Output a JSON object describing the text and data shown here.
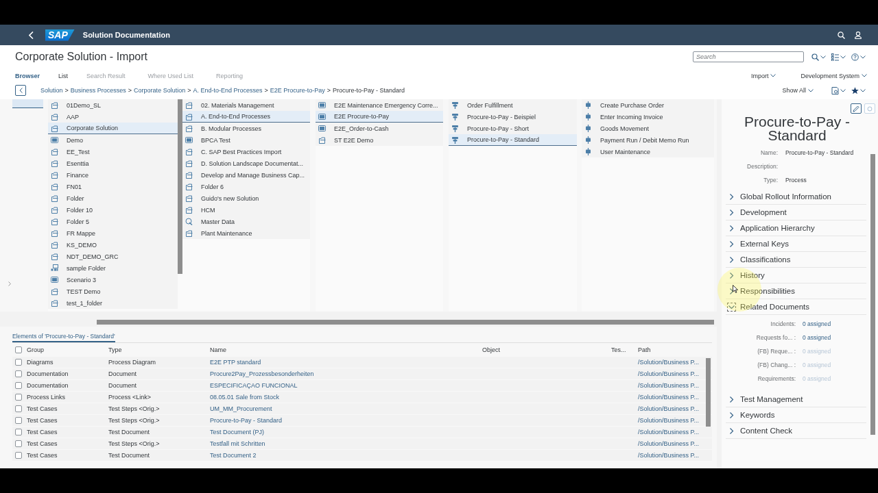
{
  "shell": {
    "title": "Solution Documentation",
    "logo": "SAP"
  },
  "header": {
    "title": "Corporate Solution - Import",
    "search": {
      "placeholder": "Search"
    },
    "tabs": [
      {
        "label": "Browser",
        "selected": true,
        "disabled": false
      },
      {
        "label": "List",
        "selected": false,
        "disabled": false
      },
      {
        "label": "Search Result",
        "selected": false,
        "disabled": true
      },
      {
        "label": "Where Used List",
        "selected": false,
        "disabled": true
      },
      {
        "label": "Reporting",
        "selected": false,
        "disabled": true
      }
    ],
    "menus": [
      "Import",
      "Development System"
    ],
    "breadcrumb": {
      "separator": ">",
      "items": [
        {
          "label": "Solution",
          "current": false
        },
        {
          "label": "Business Processes",
          "current": false
        },
        {
          "label": "Corporate Solution",
          "current": false
        },
        {
          "label": "A. End-to-End Processes",
          "current": false
        },
        {
          "label": "E2E Procure-to-Pay",
          "current": false
        },
        {
          "label": "Procure-to-Pay - Standard",
          "current": true
        }
      ]
    },
    "show_all": "Show All"
  },
  "columns": [
    {
      "items": [
        {
          "label": "01Demo_SL",
          "kind": "folder",
          "selected": false
        },
        {
          "label": "AAP",
          "kind": "folder",
          "selected": false
        },
        {
          "label": "Corporate Solution",
          "kind": "folder",
          "selected": true
        },
        {
          "label": "Demo",
          "kind": "scenario",
          "selected": false
        },
        {
          "label": "EE_Test",
          "kind": "folder",
          "selected": false
        },
        {
          "label": "Esenttia",
          "kind": "folder",
          "selected": false
        },
        {
          "label": "Finance",
          "kind": "folder",
          "selected": false
        },
        {
          "label": "FN01",
          "kind": "folder",
          "selected": false
        },
        {
          "label": "Folder",
          "kind": "folder",
          "selected": false
        },
        {
          "label": "Folder 10",
          "kind": "folder",
          "selected": false
        },
        {
          "label": "Folder 5",
          "kind": "folder",
          "selected": false
        },
        {
          "label": "FR Mappe",
          "kind": "folder",
          "selected": false
        },
        {
          "label": "KS_DEMO",
          "kind": "folder",
          "selected": false
        },
        {
          "label": "NDT_DEMO_GRC",
          "kind": "folder",
          "selected": false
        },
        {
          "label": "sample Folder",
          "kind": "structure",
          "selected": false
        },
        {
          "label": "Scenario 3",
          "kind": "scenario",
          "selected": false
        },
        {
          "label": "TEST Demo",
          "kind": "folder",
          "selected": false
        },
        {
          "label": "test_1_folder",
          "kind": "folder",
          "selected": false
        }
      ]
    },
    {
      "items": [
        {
          "label": "02. Materials Management",
          "kind": "folder",
          "selected": false
        },
        {
          "label": "A. End-to-End Processes",
          "kind": "folder",
          "selected": true
        },
        {
          "label": "B. Modular Processes",
          "kind": "folder",
          "selected": false
        },
        {
          "label": "BPCA Test",
          "kind": "scenario",
          "selected": false
        },
        {
          "label": "C. SAP Best Practices Import",
          "kind": "folder",
          "selected": false
        },
        {
          "label": "D. Solution Landscape Documentat...",
          "kind": "folder",
          "selected": false
        },
        {
          "label": "Develop and Manage Business Cap...",
          "kind": "folder",
          "selected": false
        },
        {
          "label": "Folder 6",
          "kind": "folder",
          "selected": false
        },
        {
          "label": "Guido's new Solution",
          "kind": "folder",
          "selected": false
        },
        {
          "label": "HCM",
          "kind": "folder",
          "selected": false
        },
        {
          "label": "Master Data",
          "kind": "master",
          "selected": false
        },
        {
          "label": "Plant Maintenance",
          "kind": "folder",
          "selected": false
        }
      ]
    },
    {
      "items": [
        {
          "label": "E2E Maintenance Emergency Corre...",
          "kind": "scenario",
          "selected": false
        },
        {
          "label": "E2E Procure-to-Pay",
          "kind": "scenario",
          "selected": true
        },
        {
          "label": "E2E_Order-to-Cash",
          "kind": "scenario",
          "selected": false
        },
        {
          "label": "ST E2E Demo",
          "kind": "folder",
          "selected": false
        }
      ]
    },
    {
      "items": [
        {
          "label": "Order Fulfillment",
          "kind": "process",
          "selected": false
        },
        {
          "label": "Procure-to-Pay - Beispiel",
          "kind": "process",
          "selected": false
        },
        {
          "label": "Procure-to-Pay - Short",
          "kind": "process",
          "selected": false
        },
        {
          "label": "Procure-to-Pay - Standard",
          "kind": "process",
          "selected": true
        }
      ]
    },
    {
      "items": [
        {
          "label": "Create Purchase Order",
          "kind": "step",
          "selected": false
        },
        {
          "label": "Enter Incoming Invoice",
          "kind": "step",
          "selected": false
        },
        {
          "label": "Goods Movement",
          "kind": "step",
          "selected": false
        },
        {
          "label": "Payment Run / Debit Memo Run",
          "kind": "step",
          "selected": false
        },
        {
          "label": "User Maintenance",
          "kind": "step",
          "selected": false
        }
      ]
    }
  ],
  "elements": {
    "tab": "Elements of 'Procure-to-Pay - Standard'",
    "columns": [
      "Group",
      "Type",
      "Name",
      "Object",
      "Tes...",
      "Path"
    ],
    "select_all": {
      "checked": false
    },
    "rows": [
      {
        "checked": false,
        "group": "Diagrams",
        "type": "Process Diagram",
        "name": "E2E PTP standard",
        "path": "/Solution/Business P..."
      },
      {
        "checked": false,
        "group": "Documentation",
        "type": "Document",
        "name": "Procure2Pay_Prozessbesonderheiten",
        "path": "/Solution/Business P..."
      },
      {
        "checked": false,
        "group": "Documentation",
        "type": "Document",
        "name": "ESPECIFICAÇAO FUNCIONAL",
        "path": "/Solution/Business P..."
      },
      {
        "checked": false,
        "group": "Process Links",
        "type": "Process <Link>",
        "name": "08.05.01 Sale from Stock",
        "path": "/Solution/Business P..."
      },
      {
        "checked": false,
        "group": "Test Cases",
        "type": "Test Steps <Orig.>",
        "name": "UM_MM_Procurement",
        "path": "/Solution/Business P..."
      },
      {
        "checked": false,
        "group": "Test Cases",
        "type": "Test Steps <Orig.>",
        "name": "Procure-to-Pay - Standard",
        "path": "/Solution/Business P..."
      },
      {
        "checked": false,
        "group": "Test Cases",
        "type": "Test Document",
        "name": "Test Document (PJ)",
        "path": "/Solution/Business P..."
      },
      {
        "checked": false,
        "group": "Test Cases",
        "type": "Test Steps <Orig.>",
        "name": "Testfall mit Schritten",
        "path": "/Solution/Business P..."
      },
      {
        "checked": false,
        "group": "Test Cases",
        "type": "Test Document",
        "name": "Test Document 2",
        "path": "/Solution/Business P..."
      }
    ]
  },
  "detail": {
    "title": "Procure-to-Pay - Standard",
    "properties": [
      {
        "label": "Name:",
        "value": "Procure-to-Pay - Standard"
      },
      {
        "label": "Description:"
      },
      {
        "label": "Type:",
        "value": "Process"
      }
    ],
    "sections": [
      {
        "label": "Global Rollout Information",
        "expanded": false
      },
      {
        "label": "Development",
        "expanded": false
      },
      {
        "label": "Application Hierarchy",
        "expanded": false
      },
      {
        "label": "External Keys",
        "expanded": false
      },
      {
        "label": "Classifications",
        "expanded": false
      },
      {
        "label": "History",
        "expanded": false
      },
      {
        "label": "Responsibilities",
        "expanded": false
      },
      {
        "label": "Related Documents",
        "expanded": true,
        "rows": [
          {
            "label": "Incidents:",
            "value": "0 assigned",
            "disabled": false
          },
          {
            "label": "Requests fo... :",
            "value": "0 assigned",
            "disabled": false
          },
          {
            "label": "(FB) Reque... :",
            "value": "0 assigned",
            "disabled": true
          },
          {
            "label": "(FB) Chang... :",
            "value": "0 assigned",
            "disabled": true
          },
          {
            "label": "Requirements:",
            "value": "0 assigned",
            "disabled": true
          }
        ]
      },
      {
        "label": "Test Management",
        "expanded": false
      },
      {
        "label": "Keywords",
        "expanded": false
      },
      {
        "label": "Content Check",
        "expanded": false
      }
    ]
  }
}
